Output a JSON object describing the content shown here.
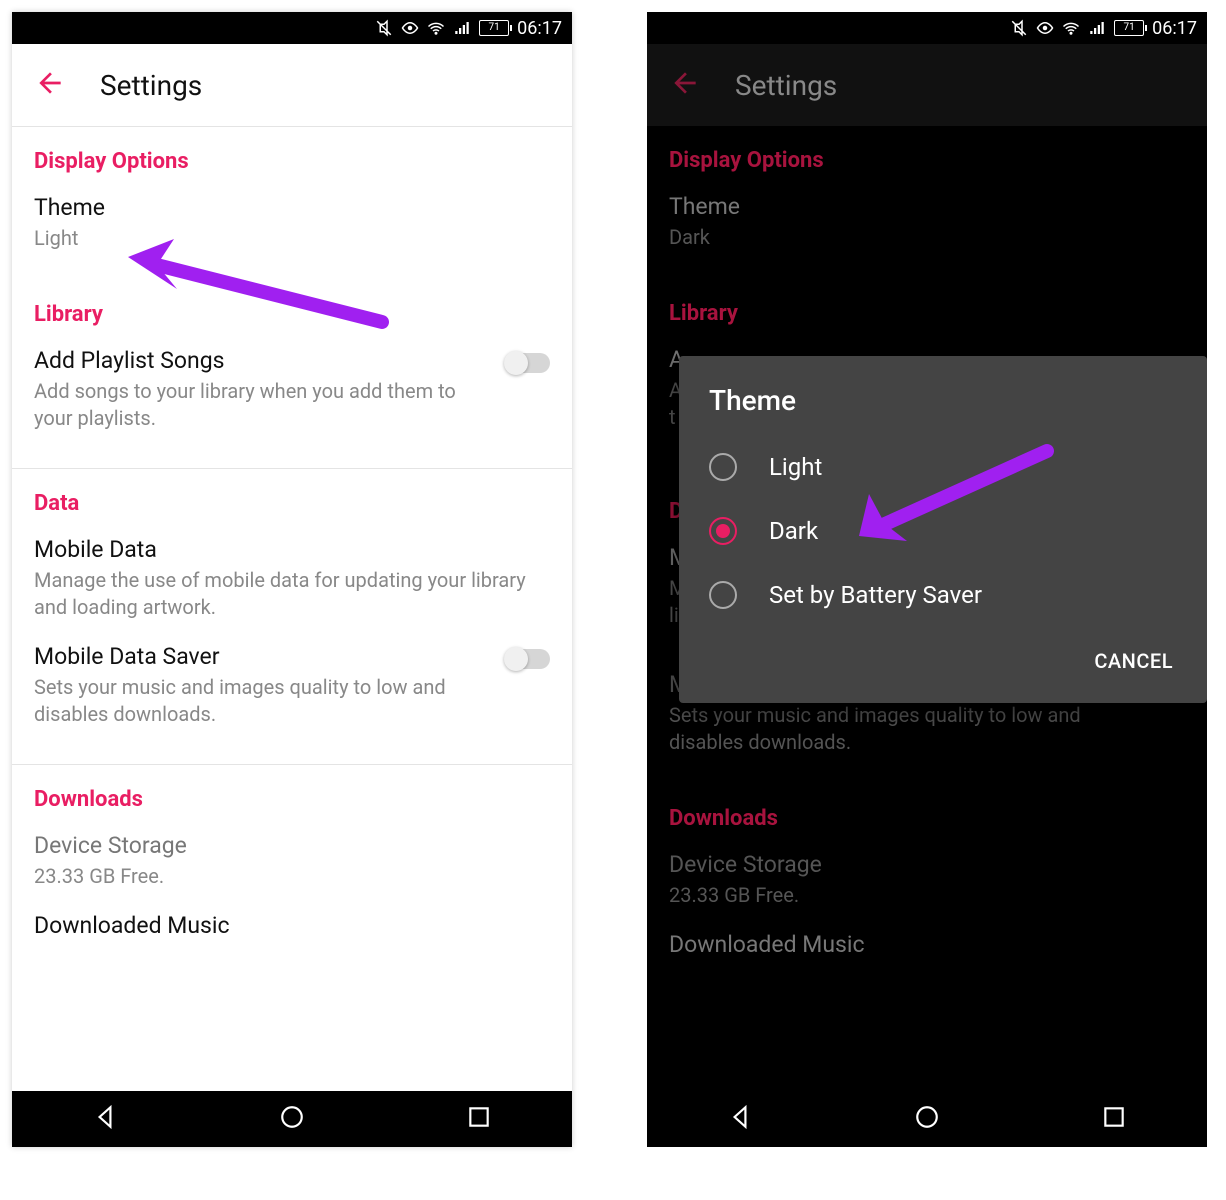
{
  "statusbar": {
    "battery": "71",
    "time": "06:17"
  },
  "header": {
    "title": "Settings"
  },
  "left": {
    "sections": {
      "display": {
        "title": "Display Options",
        "theme_label": "Theme",
        "theme_value": "Light"
      },
      "library": {
        "title": "Library",
        "add_playlist_label": "Add Playlist Songs",
        "add_playlist_sub": "Add songs to your library when you add them to your playlists."
      },
      "data": {
        "title": "Data",
        "mobile_data_label": "Mobile Data",
        "mobile_data_sub": "Manage the use of mobile data for updating your library and loading artwork.",
        "saver_label": "Mobile Data Saver",
        "saver_sub": "Sets your music and images quality to low and disables downloads."
      },
      "downloads": {
        "title": "Downloads",
        "storage_label": "Device Storage",
        "storage_value": "23.33 GB Free.",
        "downloaded_music": "Downloaded Music"
      }
    }
  },
  "right": {
    "sections": {
      "display": {
        "title": "Display Options",
        "theme_label": "Theme",
        "theme_value": "Dark"
      },
      "library": {
        "title": "Library",
        "add_prefix_a": "A",
        "add_prefix_a2": "A",
        "add_prefix_t": "t"
      },
      "data": {
        "title": "D",
        "mobile_m": "M",
        "mobile_m2": "M",
        "mobile_l": "li",
        "saver_m": "M",
        "saver_label": "Mobile Data Saver",
        "saver_sub": "Sets your music and images quality to low and disables downloads."
      },
      "downloads": {
        "title": "Downloads",
        "storage_label": "Device Storage",
        "storage_value": "23.33 GB Free.",
        "downloaded_music": "Downloaded Music"
      }
    },
    "dialog": {
      "title": "Theme",
      "options": {
        "light": "Light",
        "dark": "Dark",
        "battery": "Set by Battery Saver"
      },
      "cancel": "CANCEL"
    }
  }
}
